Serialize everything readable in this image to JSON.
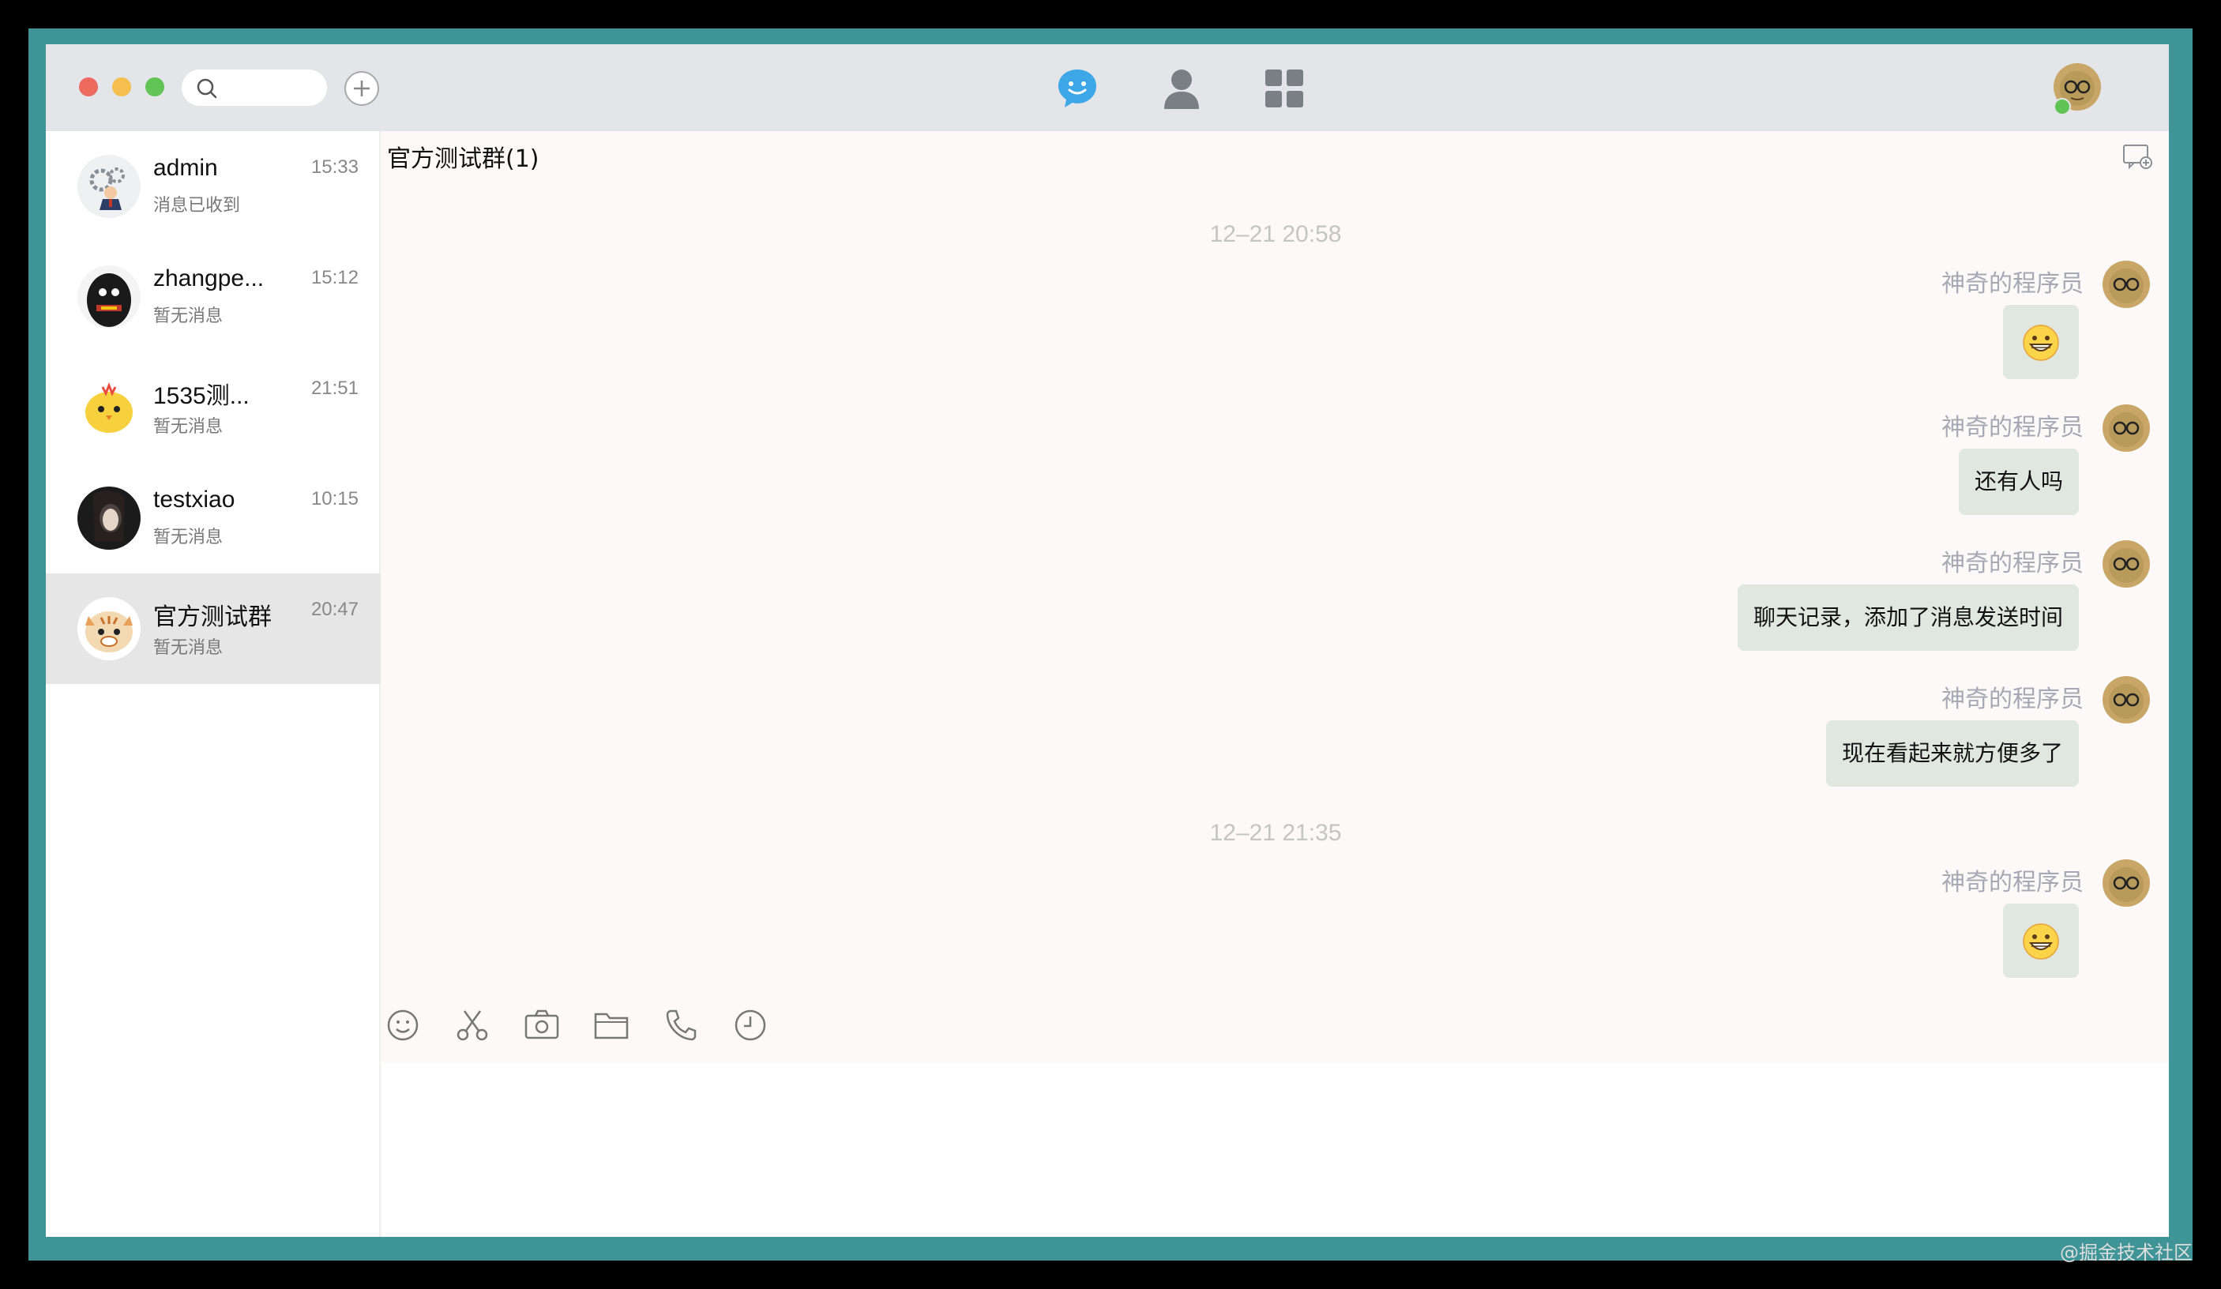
{
  "search": {
    "placeholder": ""
  },
  "nav": {
    "chat": "chat-icon",
    "contacts": "contacts-icon",
    "apps": "apps-grid-icon"
  },
  "conversations": [
    {
      "name": "admin",
      "time": "15:33",
      "preview": "消息已收到"
    },
    {
      "name": "zhangpe...",
      "time": "15:12",
      "preview": "暂无消息"
    },
    {
      "name": "1535测...",
      "time": "21:51",
      "preview": "暂无消息"
    },
    {
      "name": "testxiao",
      "time": "10:15",
      "preview": "暂无消息"
    },
    {
      "name": "官方测试群",
      "time": "20:47",
      "preview": "暂无消息"
    }
  ],
  "chat": {
    "title": "官方测试群(1)",
    "time_separators": [
      "12–21 20:58",
      "12–21 21:35"
    ],
    "messages": [
      {
        "sender": "神奇的程序员",
        "text": "",
        "type": "emoji"
      },
      {
        "sender": "神奇的程序员",
        "text": "还有人吗",
        "type": "text"
      },
      {
        "sender": "神奇的程序员",
        "text": "聊天记录，添加了消息发送时间",
        "type": "text"
      },
      {
        "sender": "神奇的程序员",
        "text": "现在看起来就方便多了",
        "type": "text"
      },
      {
        "sender": "神奇的程序员",
        "text": "",
        "type": "emoji"
      }
    ]
  },
  "toolbar": [
    "emoji-icon",
    "scissors-icon",
    "camera-icon",
    "folder-icon",
    "phone-icon",
    "history-clock-icon"
  ],
  "colors": {
    "accent": "#3ea7e8",
    "frame": "#3f9497",
    "bubble": "#e0e6e0",
    "active_item": "#e6e6e6"
  },
  "watermark": "@掘金技术社区"
}
